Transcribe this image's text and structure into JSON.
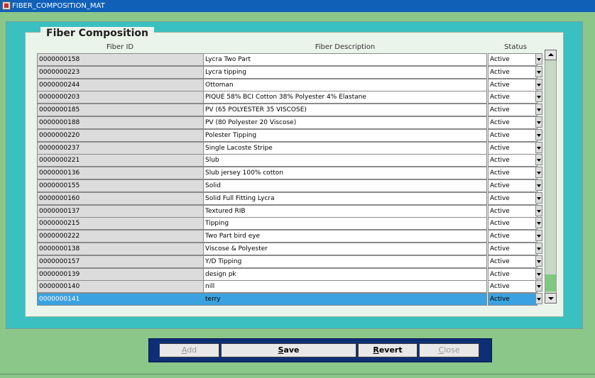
{
  "window": {
    "title": "FIBER_COMPOSITION_MAT"
  },
  "panel": {
    "title": "Fiber Composition"
  },
  "columns": {
    "id": "Fiber ID",
    "description": "Fiber Description",
    "status": "Status"
  },
  "rows": [
    {
      "id": "0000000158",
      "description": "Lycra Two Part",
      "status": "Active"
    },
    {
      "id": "0000000223",
      "description": "Lycra tipping",
      "status": "Active"
    },
    {
      "id": "0000000244",
      "description": "Ottoman",
      "status": "Active"
    },
    {
      "id": "0000000203",
      "description": "PIQUE 58% BCI Cotton 38% Polyester 4% Elastane",
      "status": "Active"
    },
    {
      "id": "0000000185",
      "description": "PV (65 POLYESTER 35 VISCOSE)",
      "status": "Active"
    },
    {
      "id": "0000000188",
      "description": "PV (80 Polyester 20 Viscose)",
      "status": "Active"
    },
    {
      "id": "0000000220",
      "description": "Polester Tipping",
      "status": "Active"
    },
    {
      "id": "0000000237",
      "description": "Single Lacoste  Stripe",
      "status": "Active"
    },
    {
      "id": "0000000221",
      "description": "Slub",
      "status": "Active"
    },
    {
      "id": "0000000136",
      "description": "Slub jersey 100% cotton",
      "status": "Active"
    },
    {
      "id": "0000000155",
      "description": "Solid",
      "status": "Active"
    },
    {
      "id": "0000000160",
      "description": "Solid Full Fitting Lycra",
      "status": "Active"
    },
    {
      "id": "0000000137",
      "description": "Textured RIB",
      "status": "Active"
    },
    {
      "id": "0000000215",
      "description": "Tipping",
      "status": "Active"
    },
    {
      "id": "0000000222",
      "description": "Two Part bird eye",
      "status": "Active"
    },
    {
      "id": "0000000138",
      "description": "Viscose & Polyester",
      "status": "Active"
    },
    {
      "id": "0000000157",
      "description": "Y/D Tipping",
      "status": "Active"
    },
    {
      "id": "0000000139",
      "description": "design pk",
      "status": "Active"
    },
    {
      "id": "0000000140",
      "description": "nill",
      "status": "Active"
    },
    {
      "id": "0000000141",
      "description": "terry",
      "status": "Active"
    }
  ],
  "selected_row": 19,
  "buttons": {
    "add": {
      "first": "A",
      "rest": "dd"
    },
    "save": {
      "first": "S",
      "rest": "ave"
    },
    "revert": {
      "first": "R",
      "rest": "evert"
    },
    "close": {
      "first": "C",
      "rest": "lose"
    }
  },
  "colors": {
    "background": "#8cc78a",
    "teal": "#3ac0c0",
    "selection": "#3aa2e0",
    "button_bar": "#0e2f76"
  },
  "icons": {
    "window": "form-window-icon",
    "dropdown": "chevron-down-icon",
    "scroll_up": "arrow-up-icon",
    "scroll_down": "arrow-down-icon"
  }
}
